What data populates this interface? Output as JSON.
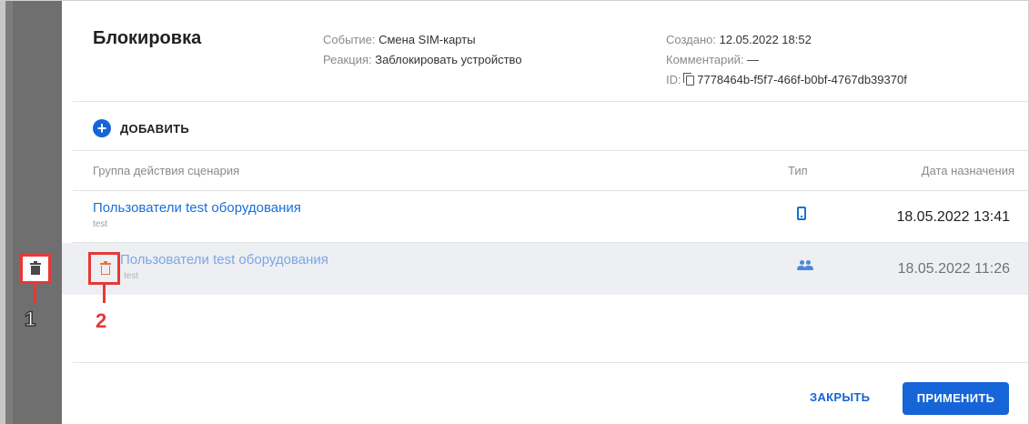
{
  "header": {
    "title": "Блокировка",
    "event_label": "Событие: ",
    "event_value": "Смена SIM-карты",
    "reaction_label": "Реакция: ",
    "reaction_value": "Заблокировать устройство",
    "created_label": "Создано: ",
    "created_value": "12.05.2022 18:52",
    "comment_label": "Комментарий: ",
    "comment_value": "—",
    "id_label": "ID: ",
    "id_value": "7778464b-f5f7-466f-b0bf-4767db39370f"
  },
  "add_button": {
    "icon": "+",
    "label": "ДОБАВИТЬ"
  },
  "table": {
    "columns": [
      "Группа действия сценария",
      "Тип",
      "Дата назначения"
    ],
    "rows": [
      {
        "name": "Пользователи test оборудования",
        "sub": "test",
        "type_icon": "phone-icon",
        "date": "18.05.2022 13:41"
      },
      {
        "name": "Пользователи test оборудования",
        "sub": "test",
        "type_icon": "people-icon",
        "date": "18.05.2022 11:26"
      }
    ]
  },
  "annotations": [
    {
      "label": "1",
      "color": "#ffffff"
    },
    {
      "label": "2",
      "color": "#e53935"
    }
  ],
  "footer": {
    "close_label": "ЗАКРЫТЬ",
    "apply_label": "ПРИМЕНИТЬ"
  },
  "colors": {
    "accent": "#1565d8",
    "link": "#1a6fd6",
    "annotation": "#e53935",
    "row_highlight": "#edeff3"
  }
}
